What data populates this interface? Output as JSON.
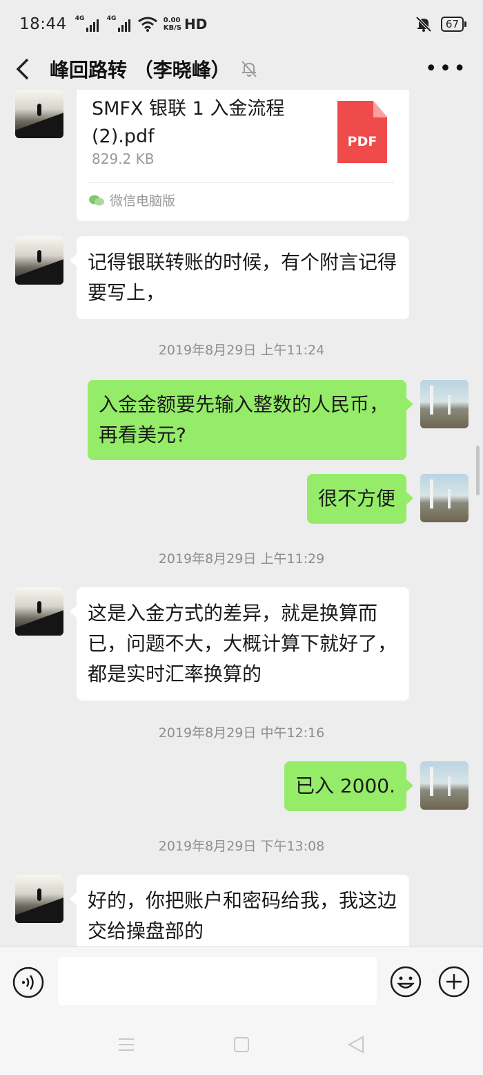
{
  "status_bar": {
    "time": "18:44",
    "network_1": "4G",
    "network_2": "4G",
    "speed_value": "0.00",
    "speed_unit": "KB/S",
    "hd_label": "HD",
    "battery": "67",
    "icons": [
      "signal-icon",
      "wifi-icon",
      "mute-bell-icon",
      "battery-icon"
    ]
  },
  "header": {
    "title": "峰回路转 （李晓峰）",
    "icons": [
      "back-icon",
      "mute-icon",
      "more-icon"
    ]
  },
  "messages": {
    "file": {
      "name": "SMFX 银联 1 入金流程(2).pdf",
      "size": "829.2 KB",
      "type_label": "PDF",
      "source": "微信电脑版"
    },
    "m1": "记得银联转账的时候，有个附言记得要写上，",
    "t1": "2019年8月29日 上午11:24",
    "m2": "入金金额要先输入整数的人民币，再看美元?",
    "m3": "很不方便",
    "t2": "2019年8月29日 上午11:29",
    "m4": "这是入金方式的差异，就是换算而已，问题不大，大概计算下就好了，都是实时汇率换算的",
    "t3": "2019年8月29日 中午12:16",
    "m5": "已入 2000.",
    "t4": "2019年8月29日 下午13:08",
    "m6": "好的，你把账户和密码给我，我这边交给操盘部的"
  },
  "input_bar": {
    "placeholder": "",
    "icons": [
      "voice-icon",
      "emoji-icon",
      "plus-icon"
    ]
  },
  "nav_bar": {
    "icons": [
      "menu-icon",
      "home-icon",
      "back-triangle-icon"
    ]
  },
  "colors": {
    "chat_bg": "#ededed",
    "sent_bubble": "#95ec69",
    "received_bubble": "#ffffff",
    "pdf_red": "#f04b4b"
  }
}
